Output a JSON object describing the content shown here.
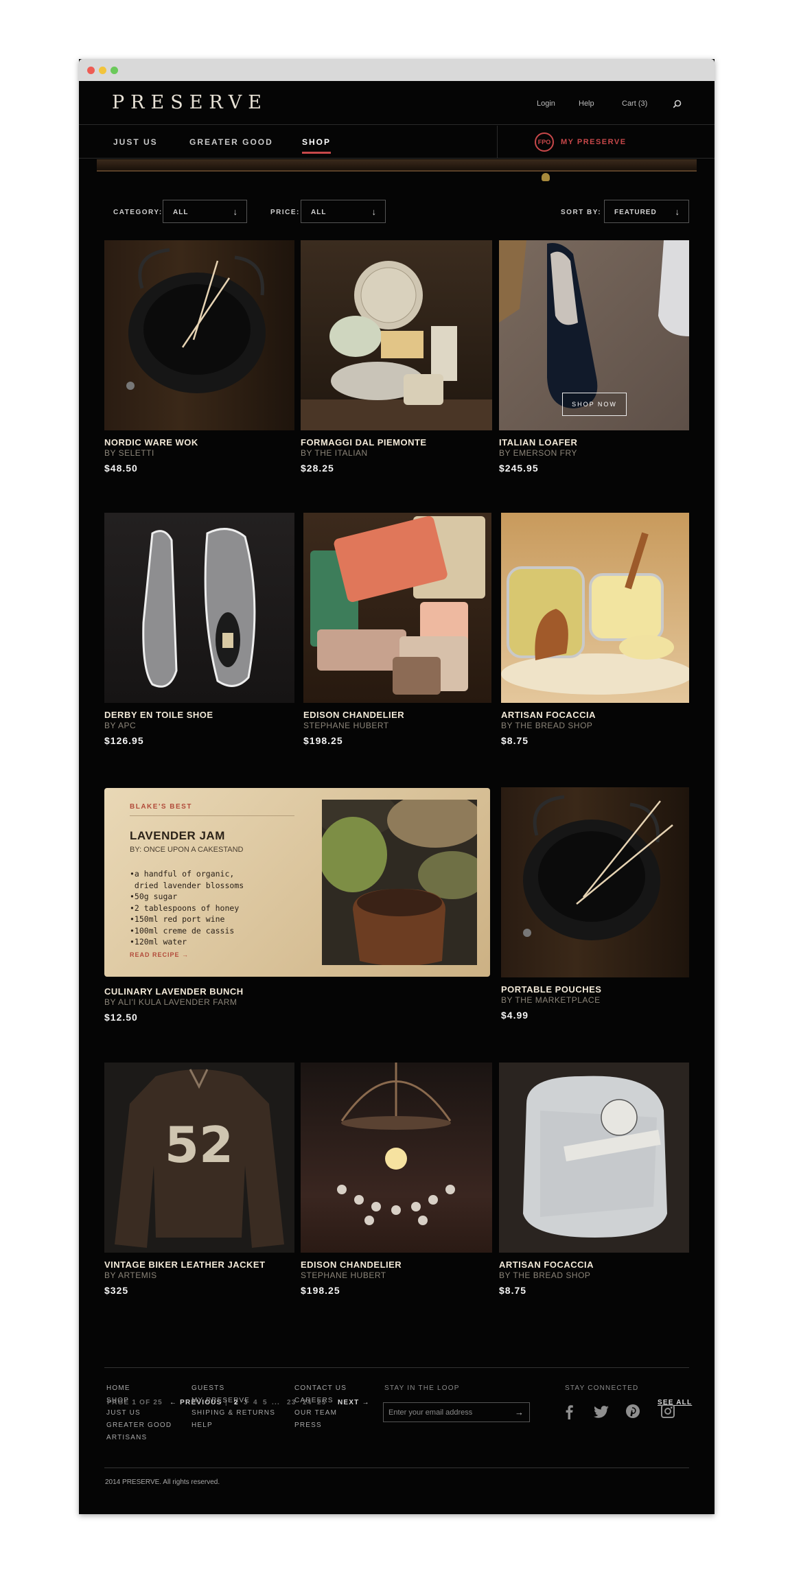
{
  "header": {
    "logo": "PRESERVE",
    "login": "Login",
    "help": "Help",
    "cart": "Cart (3)"
  },
  "nav": {
    "items": [
      "JUST US",
      "GREATER GOOD",
      "SHOP"
    ],
    "fpo": "FPO",
    "my_preserve": "MY PRESERVE"
  },
  "filters": {
    "category_label": "CATEGORY:",
    "category_value": "ALL",
    "price_label": "PRICE:",
    "price_value": "ALL",
    "sort_label": "SORT BY:",
    "sort_value": "FEATURED"
  },
  "products": [
    {
      "name": "NORDIC WARE WOK",
      "by": "BY SELETTI",
      "price": "$48.50"
    },
    {
      "name": "FORMAGGI DAL PIEMONTE",
      "by": "BY THE ITALIAN",
      "price": "$28.25"
    },
    {
      "name": "ITALIAN LOAFER",
      "by": "BY EMERSON FRY",
      "price": "$245.95",
      "action": "SHOP NOW"
    },
    {
      "name": "DERBY EN TOILE SHOE",
      "by": "BY APC",
      "price": "$126.95"
    },
    {
      "name": "EDISON CHANDELIER",
      "by": "STEPHANE HUBERT",
      "price": "$198.25"
    },
    {
      "name": "ARTISAN FOCACCIA",
      "by": "BY THE BREAD SHOP",
      "price": "$8.75"
    },
    {
      "name": "CULINARY LAVENDER BUNCH",
      "by": "BY ALI'I KULA LAVENDER FARM",
      "price": "$12.50"
    },
    {
      "name": "PORTABLE POUCHES",
      "by": "BY THE MARKETPLACE",
      "price": "$4.99"
    },
    {
      "name": "VINTAGE BIKER LEATHER JACKET",
      "by": "BY ARTEMIS",
      "price": "$325"
    },
    {
      "name": "EDISON CHANDELIER",
      "by": "STEPHANE HUBERT",
      "price": "$198.25"
    },
    {
      "name": "ARTISAN FOCACCIA",
      "by": "BY THE BREAD SHOP",
      "price": "$8.75"
    }
  ],
  "recipe": {
    "tag": "BLAKE'S BEST",
    "title": "LAVENDER JAM",
    "by": "BY: ONCE UPON A CAKESTAND",
    "ingredients": "•a handful of organic,\n dried lavender blossoms\n•50g sugar\n•2 tablespoons of honey\n•150ml red port wine\n•100ml creme de cassis\n•120ml water",
    "read": "READ RECIPE →"
  },
  "jacket_number": "52",
  "pagination": {
    "page_info": "PAGE 1 OF 25",
    "previous": "← PREVIOUS",
    "separator": "|",
    "current": "2",
    "pages": [
      "3",
      "4",
      "5",
      "...",
      "23",
      "24",
      "25"
    ],
    "next": "NEXT →",
    "see_all": "SEE ALL"
  },
  "footer": {
    "col1": [
      "HOME",
      "SHOP",
      "JUST US",
      "GREATER GOOD",
      "ARTISANS"
    ],
    "col2": [
      "GUESTS",
      "MY PRESERVE",
      "SHIPING & RETURNS",
      "HELP"
    ],
    "col3": [
      "CONTACT US",
      "CAREERS",
      "OUR TEAM",
      "PRESS"
    ],
    "stay_loop": "STAY IN THE LOOP",
    "email_placeholder": "Enter your email address",
    "stay_connected": "STAY CONNECTED",
    "social": [
      "facebook-icon",
      "twitter-icon",
      "pinterest-icon",
      "instagram-icon"
    ],
    "copyright": "2014 PRESERVE. All rights reserved."
  },
  "colors": {
    "accent": "#c8484a",
    "background": "#050505",
    "product_name": "#f2e9d8"
  }
}
